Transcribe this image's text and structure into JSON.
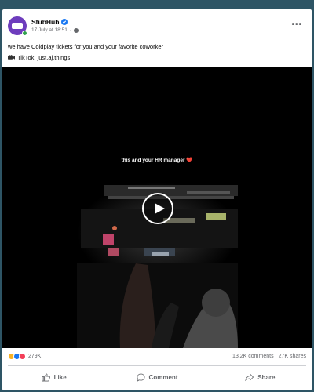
{
  "post": {
    "page_name": "StubHub",
    "timestamp": "17 July at 18:51",
    "separator": "·",
    "caption": "we have Coldplay tickets for you and your favorite coworker",
    "tiktok_label": "TikTok: just.aj.things"
  },
  "video": {
    "overlay_text": "this and your HR manager ❤️"
  },
  "stats": {
    "reaction_count": "279K",
    "comments": "13.2K comments",
    "shares": "27K shares"
  },
  "actions": {
    "like": "Like",
    "comment": "Comment",
    "share": "Share"
  },
  "colors": {
    "background": "#2e5565",
    "avatar": "#6e3dbd",
    "verified": "#1877f2",
    "secondary_text": "#65676b"
  },
  "icons": [
    "more-options-icon",
    "verified-badge-icon",
    "globe-icon",
    "video-camera-icon",
    "play-icon",
    "haha-reaction-icon",
    "like-reaction-icon",
    "love-reaction-icon",
    "like-icon",
    "comment-icon",
    "share-icon"
  ]
}
